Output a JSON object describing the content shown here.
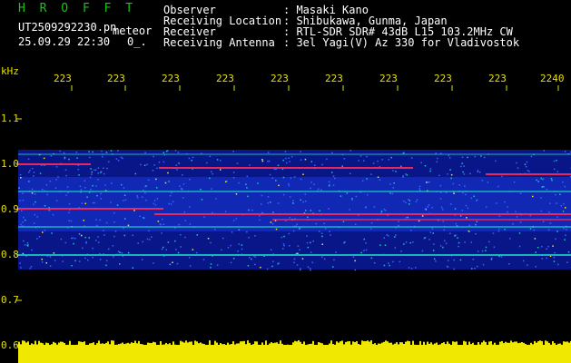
{
  "header": {
    "app_title": "H R O F F T",
    "file_name": "UT2509292230.pn",
    "file_suffix": "meteor",
    "date_time": "25.09.29 22:30",
    "extra": "0_.",
    "labels": {
      "observer": "Observer",
      "location": "Receiving Location",
      "receiver": "Receiver",
      "antenna": "Receiving Antenna"
    },
    "values": {
      "observer": ": Masaki Kano",
      "location": ": Shibukawa, Gunma, Japan",
      "receiver": ": RTL-SDR SDR# 43dB L15 103.2MHz CW",
      "antenna": ": 3el Yagi(V) Az 330 for Vladivostok"
    }
  },
  "axis": {
    "unit": "kHz",
    "y_ticks": [
      "1.1",
      "1.0",
      "0.9",
      "0.8",
      "0.7",
      "0.6"
    ],
    "x_ticks": [
      "223",
      "223",
      "223",
      "223",
      "223",
      "223",
      "223",
      "223",
      "223",
      "2240"
    ]
  },
  "colors": {
    "header_text": "#ffffff",
    "title_text": "#19c419",
    "axis_text": "#e8e000",
    "background": "#000000",
    "signal_low": "#0a1aa0",
    "signal_mid": "#19c4c4",
    "signal_high": "#ff2a5a",
    "bottom_strip": "#f0e800"
  }
}
